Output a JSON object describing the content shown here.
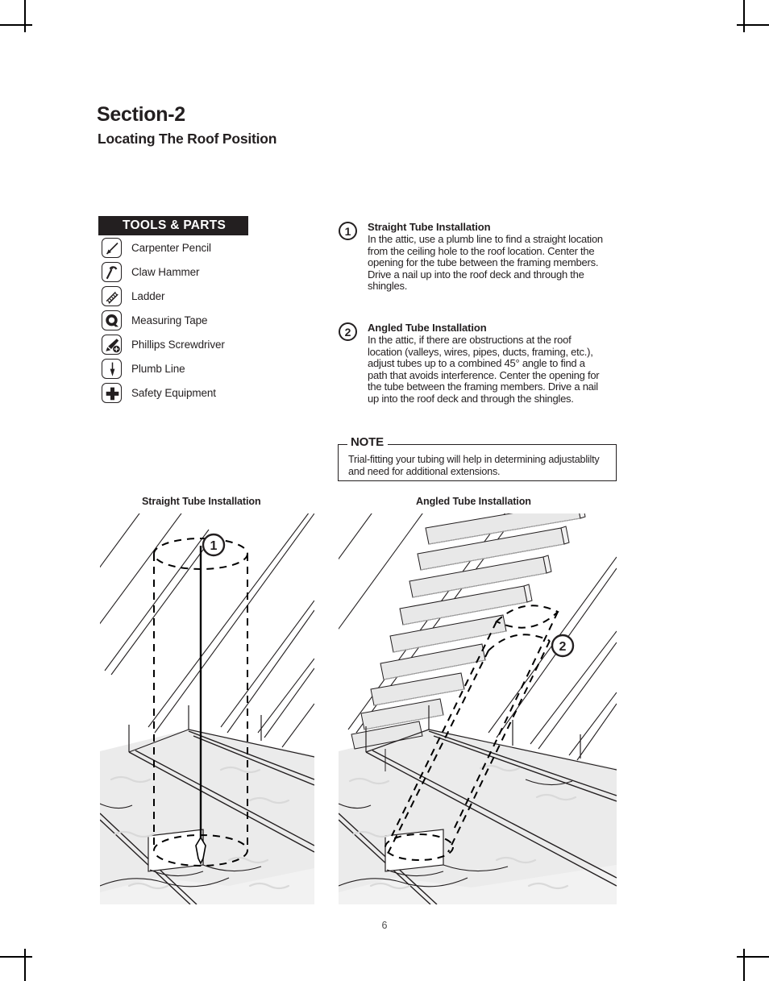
{
  "document": {
    "section_title": "Section-2",
    "section_subtitle": "Locating The Roof Position",
    "page_number": "6"
  },
  "tools_panel": {
    "header": "TOOLS & PARTS",
    "items": [
      {
        "label": "Carpenter Pencil",
        "icon": "carpenter-pencil-icon"
      },
      {
        "label": "Claw Hammer",
        "icon": "claw-hammer-icon"
      },
      {
        "label": "Ladder",
        "icon": "ladder-icon"
      },
      {
        "label": "Measuring Tape",
        "icon": "measuring-tape-icon"
      },
      {
        "label": "Phillips Screwdriver",
        "icon": "phillips-screwdriver-icon"
      },
      {
        "label": "Plumb Line",
        "icon": "plumb-line-icon"
      },
      {
        "label": "Safety Equipment",
        "icon": "safety-equipment-icon"
      }
    ]
  },
  "steps": [
    {
      "number": "1",
      "title": "Straight Tube Installation",
      "text": "In the attic, use a plumb line to find a straight location from the ceiling hole to the roof location. Center the opening for the tube between the framing members. Drive a nail up into the roof deck and through the shingles."
    },
    {
      "number": "2",
      "title": "Angled Tube Installation",
      "text": "In the attic, if there are obstructions at the roof location (valleys, wires, pipes, ducts, framing, etc.), adjust tubes up to a combined 45° angle to find a path that avoids interference. Center the opening for the tube between the framing members. Drive a nail up into the roof deck and through the shingles."
    }
  ],
  "note": {
    "legend": "NOTE",
    "text": "Trial-fitting your tubing will help in determining adjustablilty and need for additional extensions."
  },
  "figures": {
    "left": {
      "caption": "Straight Tube Installation",
      "badge": "1"
    },
    "right": {
      "caption": "Angled Tube Installation",
      "badge": "2"
    }
  },
  "colors": {
    "ink": "#231f20",
    "header_bar": "#231f20",
    "header_text": "#ffffff",
    "insulation_fill": "#ebebeb",
    "shingle_fill": "#e8e8e8"
  }
}
